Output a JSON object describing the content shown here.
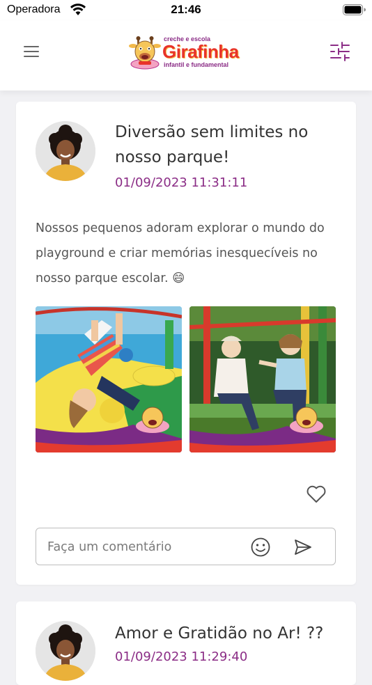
{
  "status_bar": {
    "carrier": "Operadora",
    "time": "21:46"
  },
  "app_bar": {
    "logo": {
      "top_text": "creche e escola",
      "name": "Girafinha",
      "sub_text": "infantil e fundamental"
    }
  },
  "posts": [
    {
      "title": "Diversão sem limites no nosso parque!",
      "date": "01/09/2023 11:31:11",
      "text": "Nossos pequenos adoram explorar o mundo do playground e criar memórias inesquecíveis no nosso parque escolar. 😄",
      "photos": [
        {
          "description_icon": "photo-child-upside-down"
        },
        {
          "description_icon": "photo-two-children-bench"
        }
      ],
      "comment_placeholder": "Faça um comentário"
    },
    {
      "title": "Amor e Gratidão no Ar! ??",
      "date": "01/09/2023 11:29:40"
    }
  ],
  "colors": {
    "accent": "#8b2d86",
    "logo_red": "#e8332a",
    "text": "#333333",
    "background": "#f1f1f4"
  }
}
